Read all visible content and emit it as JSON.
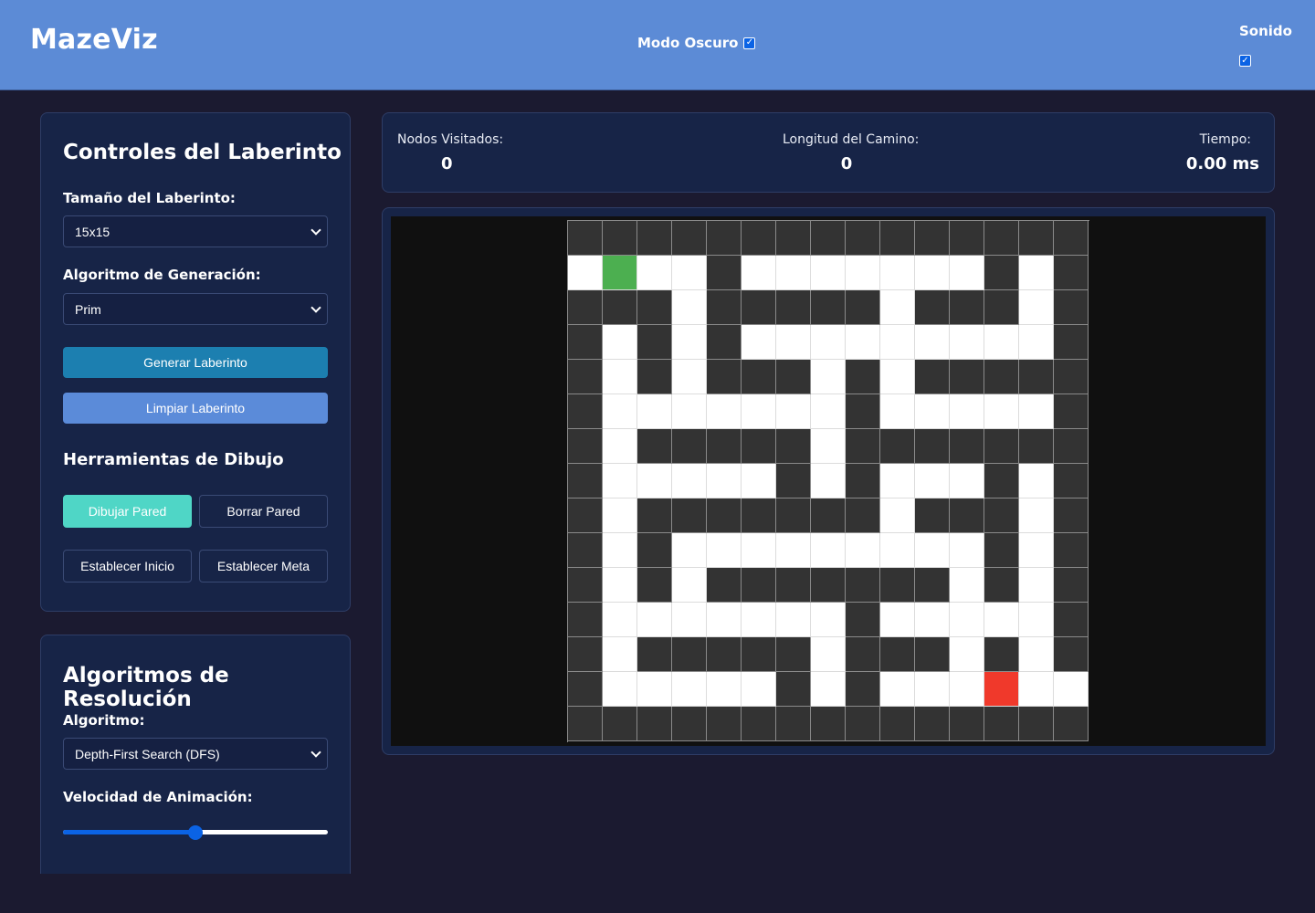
{
  "app": {
    "logo": "MazeViz",
    "dark_mode_label": "Modo Oscuro",
    "dark_mode_checked": true,
    "sound_label": "Sonido",
    "sound_checked": true
  },
  "controls": {
    "title": "Controles del Laberinto",
    "size_label": "Tamaño del Laberinto:",
    "size_value": "15x15",
    "gen_algo_label": "Algoritmo de Generación:",
    "gen_algo_value": "Prim",
    "generate_button": "Generar Laberinto",
    "clear_button": "Limpiar Laberinto",
    "tools_title": "Herramientas de Dibujo",
    "tools": {
      "draw_wall": "Dibujar Pared",
      "erase_wall": "Borrar Pared",
      "set_start": "Establecer Inicio",
      "set_goal": "Establecer Meta"
    },
    "active_tool": "draw_wall"
  },
  "solver": {
    "title": "Algoritmos de Resolución",
    "algo_label": "Algoritmo:",
    "algo_value": "Depth-First Search (DFS)",
    "speed_label": "Velocidad de Animación:",
    "speed_fraction": 0.5
  },
  "stats": {
    "visited_label": "Nodos Visitados:",
    "visited_value": "0",
    "path_label": "Longitud del Camino:",
    "path_value": "0",
    "time_label": "Tiempo:",
    "time_value": "0.00 ms"
  },
  "maze": {
    "legend": {
      "W": "wall",
      ".": "path",
      "S": "start",
      "G": "goal"
    },
    "rows": [
      "WWWWWWWWWWWWWWW",
      ".S..W.......W.W",
      "WWW.WWWWW.WWW.W",
      "W.W.W.........W",
      "W.W.WWW.W.WWWWW",
      "W.......W.....W",
      "W.WWWWW.WWWWWWW",
      "W.....W.W...W.W",
      "W.WWWWWWW.WWW.W",
      "W.W.........W.W",
      "W.W.WWWWWWW.W.W",
      "W.......W.....W",
      "W.WWWWW.WWW.W.W",
      "W.....W.W...G..",
      "WWWWWWWWWWWWWWW"
    ]
  }
}
